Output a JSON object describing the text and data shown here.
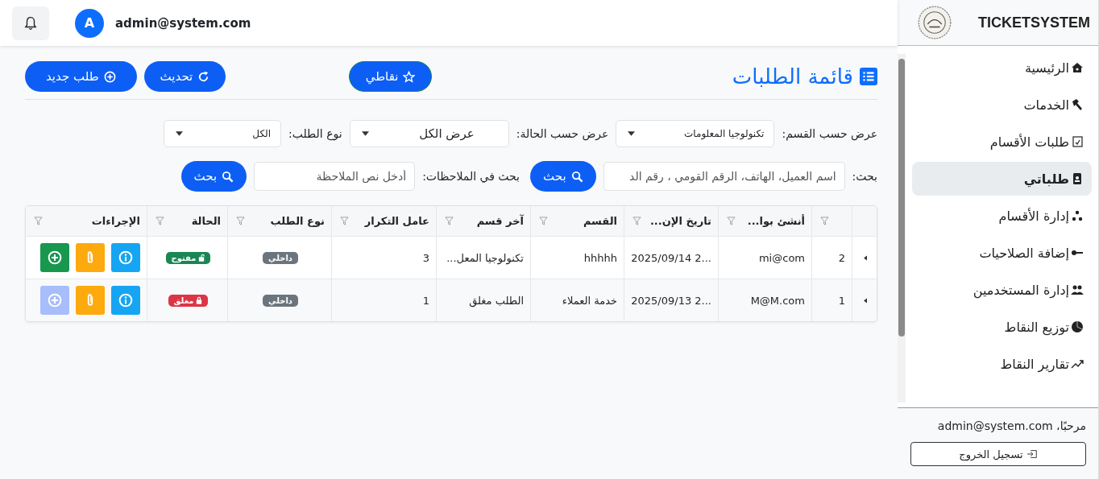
{
  "topbar": {
    "avatar": "A",
    "user": "admin@system.com"
  },
  "sidebar": {
    "brand": "TICKETSYSTEM",
    "items": [
      {
        "label": "الرئيسية",
        "selected": false
      },
      {
        "label": "الخدمات",
        "selected": false
      },
      {
        "label": "طلبات الأقسام",
        "selected": false
      },
      {
        "label": "طلباتي",
        "selected": true
      },
      {
        "label": "إدارة الأقسام",
        "selected": false
      },
      {
        "label": "إضافة الصلاحيات",
        "selected": false
      },
      {
        "label": "إدارة المستخدمين",
        "selected": false
      },
      {
        "label": "توزيع النقاط",
        "selected": false
      },
      {
        "label": "تقارير النقاط",
        "selected": false
      }
    ],
    "greeting": "مرحبًا، admin@system.com",
    "logout": "تسجيل الخروج"
  },
  "page": {
    "title": "قائمة الطلبات",
    "points_button": "نقاطي",
    "refresh_button": "تحديث",
    "new_button": "طلب جديد"
  },
  "filters": [
    {
      "label": "عرض حسب القسم:",
      "value": "تكنولوجيا المعلومات"
    },
    {
      "label": "عرض حسب الحالة:",
      "value": "عرض الكل"
    },
    {
      "label": "نوع الطلب:",
      "value": "الكل"
    }
  ],
  "searches": [
    {
      "label": "بحث:",
      "placeholder": "اسم العميل، الهاتف، الرقم القومي ، رقم الد",
      "button": "بحث"
    },
    {
      "label": "بحث في الملاحظات:",
      "placeholder": "أدخل نص الملاحظة",
      "button": "بحث"
    }
  ],
  "table": {
    "columns": [
      "أنشئ بوا...",
      "تاريخ الإن...",
      "القسم",
      "آخر قسم",
      "عامل التكرار",
      "نوع الطلب",
      "الحالة",
      "الإجراءات"
    ],
    "rows": [
      {
        "id": "2",
        "created_by": "mi@com",
        "date": "2025/09/14 2...",
        "department": "hhhhh",
        "last_department": "تكنولوجيا المعل...",
        "repeat": "3",
        "type": "داخلي",
        "status": {
          "label": "مفتوح",
          "kind": "open"
        },
        "add_disabled": false
      },
      {
        "id": "1",
        "created_by": "M@M.com",
        "date": "2025/09/13 2...",
        "department": "خدمة العملاء",
        "last_department": "الطلب مغلق",
        "repeat": "1",
        "type": "داخلي",
        "status": {
          "label": "مغلق",
          "kind": "closed"
        },
        "add_disabled": true
      }
    ]
  }
}
